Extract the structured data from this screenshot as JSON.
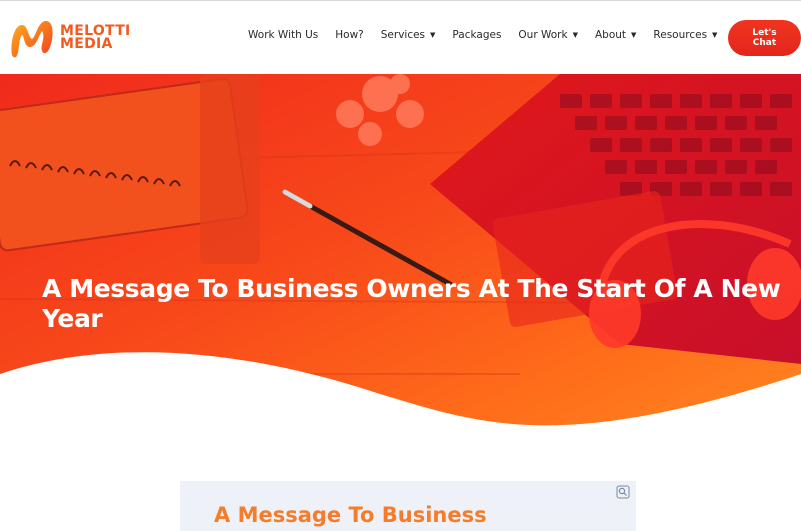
{
  "brand": {
    "name_line1": "MELOTTI",
    "name_line2": "MEDIA",
    "logo_icon": "melotti-m-logo-icon"
  },
  "nav": {
    "items": [
      {
        "label": "Work With Us",
        "dropdown": false
      },
      {
        "label": "How?",
        "dropdown": false
      },
      {
        "label": "Services",
        "dropdown": true
      },
      {
        "label": "Packages",
        "dropdown": false
      },
      {
        "label": "Our Work",
        "dropdown": true
      },
      {
        "label": "About",
        "dropdown": true
      },
      {
        "label": "Resources",
        "dropdown": true
      }
    ],
    "cta_line1": "Let's",
    "cta_line2": "Chat"
  },
  "hero": {
    "title": "A Message To Business Owners At The Start Of A New Year"
  },
  "card": {
    "title": "A Message To Business",
    "zoom_icon": "zoom-icon"
  },
  "colors": {
    "brand_orange": "#f25a1f",
    "cta_red": "#e8301e",
    "hero_red": "#f5211c",
    "hero_orange": "#ff7a1a"
  }
}
